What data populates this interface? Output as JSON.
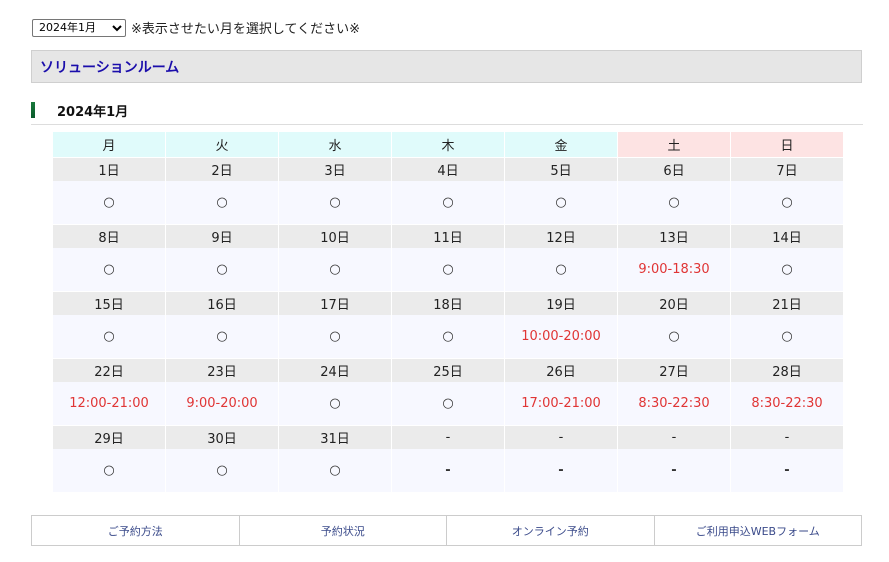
{
  "month_select": {
    "selected": "2024年1月",
    "options": [
      "2024年1月"
    ]
  },
  "month_note": "※表示させたい月を選択してください※",
  "room_title": "ソリューションルーム",
  "calendar_heading": "2024年1月",
  "weekdays": [
    "月",
    "火",
    "水",
    "木",
    "金",
    "土",
    "日"
  ],
  "weeks": [
    {
      "days": [
        "1日",
        "2日",
        "3日",
        "4日",
        "5日",
        "6日",
        "7日"
      ],
      "avail": [
        "○",
        "○",
        "○",
        "○",
        "○",
        "○",
        "○"
      ]
    },
    {
      "days": [
        "8日",
        "9日",
        "10日",
        "11日",
        "12日",
        "13日",
        "14日"
      ],
      "avail": [
        "○",
        "○",
        "○",
        "○",
        "○",
        "9:00-18:30",
        "○"
      ]
    },
    {
      "days": [
        "15日",
        "16日",
        "17日",
        "18日",
        "19日",
        "20日",
        "21日"
      ],
      "avail": [
        "○",
        "○",
        "○",
        "○",
        "10:00-20:00",
        "○",
        "○"
      ]
    },
    {
      "days": [
        "22日",
        "23日",
        "24日",
        "25日",
        "26日",
        "27日",
        "28日"
      ],
      "avail": [
        "12:00-21:00",
        "9:00-20:00",
        "○",
        "○",
        "17:00-21:00",
        "8:30-22:30",
        "8:30-22:30"
      ]
    },
    {
      "days": [
        "29日",
        "30日",
        "31日",
        "-",
        "-",
        "-",
        "-"
      ],
      "avail": [
        "○",
        "○",
        "○",
        "-",
        "-",
        "-",
        "-"
      ]
    }
  ],
  "colors": {
    "time_slot": "#e03535",
    "room_title": "#1a0dab",
    "weekday_bg": "#e0fbfb",
    "weekend_bg": "#fde3e3"
  },
  "footer_links": [
    "ご予約方法",
    "予約状況",
    "オンライン予約",
    "ご利用申込WEBフォーム"
  ]
}
